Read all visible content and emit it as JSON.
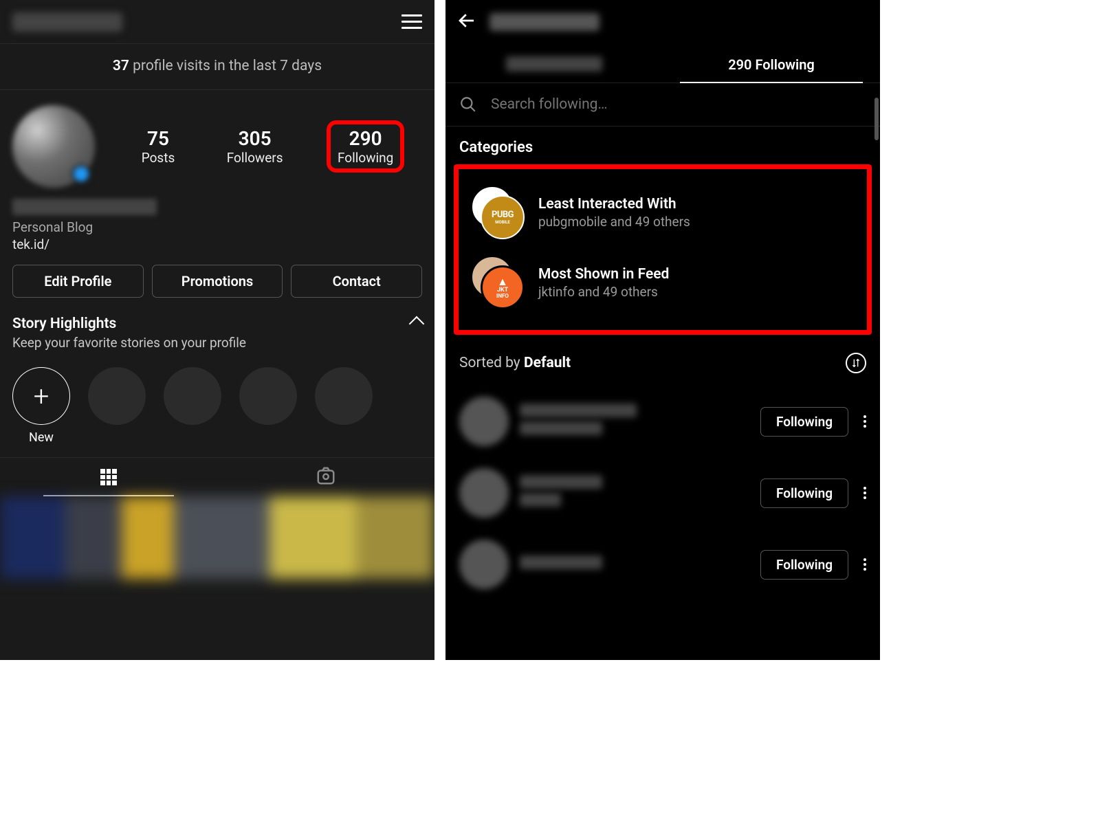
{
  "left": {
    "visits": {
      "count": "37",
      "suffix": "profile visits in the last 7 days"
    },
    "stats": {
      "posts": {
        "num": "75",
        "label": "Posts"
      },
      "followers": {
        "num": "305",
        "label": "Followers"
      },
      "following": {
        "num": "290",
        "label": "Following"
      }
    },
    "bio": {
      "category": "Personal Blog",
      "link": "tek.id/"
    },
    "buttons": {
      "edit": "Edit Profile",
      "promo": "Promotions",
      "contact": "Contact"
    },
    "story": {
      "title": "Story Highlights",
      "subtitle": "Keep your favorite stories on your profile",
      "new_label": "New",
      "add_glyph": "+"
    }
  },
  "right": {
    "tabs": {
      "following": "290 Following"
    },
    "search_placeholder": "Search following…",
    "categories_title": "Categories",
    "categories": [
      {
        "title": "Least Interacted With",
        "subtitle": "pubgmobile and 49 others",
        "badge1": "PUBG",
        "badge2": "MOBILE"
      },
      {
        "title": "Most Shown in Feed",
        "subtitle": "jktinfo and 49 others",
        "badge1": "JKT",
        "badge2": "INFO"
      }
    ],
    "sort": {
      "prefix": "Sorted by ",
      "mode": "Default"
    },
    "follow_btn": "Following"
  }
}
